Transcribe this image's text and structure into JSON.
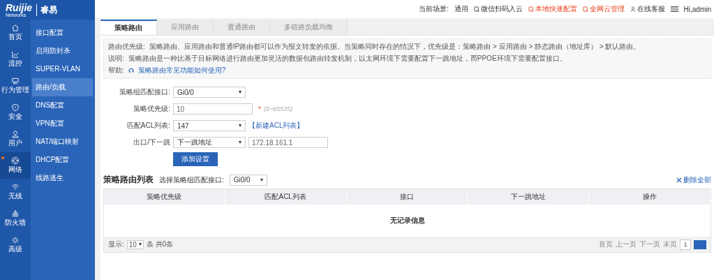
{
  "logo": {
    "brand": "Ruijie",
    "tagline": "Networks",
    "name": "睿易"
  },
  "header": {
    "scene_label": "当前场景:",
    "scene": "通用",
    "items": [
      {
        "label": "微信扫码入云",
        "emphasis": false
      },
      {
        "label": "本地快速配置",
        "emphasis": true
      },
      {
        "label": "全网云管理",
        "emphasis": true
      },
      {
        "label": "在线客服",
        "emphasis": false
      }
    ],
    "user": "Hi,admin"
  },
  "nav": [
    {
      "label": "首页",
      "selected": false
    },
    {
      "label": "流控",
      "selected": false
    },
    {
      "label": "行为管理",
      "selected": false
    },
    {
      "label": "安全",
      "selected": false
    },
    {
      "label": "用户",
      "selected": false
    },
    {
      "label": "网络",
      "selected": true
    },
    {
      "label": "无线",
      "selected": false
    },
    {
      "label": "防火墙",
      "selected": false
    },
    {
      "label": "高级",
      "selected": false
    }
  ],
  "submenu": [
    {
      "label": "接口配置",
      "selected": false
    },
    {
      "label": "启用防封杀",
      "selected": false
    },
    {
      "label": "SUPER-VLAN",
      "selected": false
    },
    {
      "label": "路由/负载",
      "selected": true
    },
    {
      "label": "DNS配置",
      "selected": false
    },
    {
      "label": "VPN配置",
      "selected": false
    },
    {
      "label": "NAT/端口映射",
      "selected": false
    },
    {
      "label": "DHCP配置",
      "selected": false
    },
    {
      "label": "线路逃生",
      "selected": false
    }
  ],
  "tabs": [
    {
      "label": "策略路由",
      "selected": true
    },
    {
      "label": "应用路由",
      "selected": false
    },
    {
      "label": "普通路由",
      "selected": false
    },
    {
      "label": "多链路负载均衡",
      "selected": false
    }
  ],
  "info": [
    {
      "label": "路由优先级:",
      "text": "策略路由、应用路由和普通IP路由都可以作为报文转发的依据。当策略同时存在的情况下，优先级是：策略路由 > 应用路由 > 静态路由（地址库） > 默认路由。"
    },
    {
      "label": "说明:",
      "text": "策略路由是一种比基于目标网络进行路由更加灵活的数据包路由转发机制，以太网环境下需要配置下一跳地址，而PPOE环境下需要配置接口。"
    }
  ],
  "help": {
    "label": "帮助:",
    "link": "策略路由常见功能如何使用?"
  },
  "form": [
    {
      "label": "策略组匹配接口:",
      "kind": "select",
      "value": "Gi0/0"
    },
    {
      "label": "策略优先级:",
      "kind": "input",
      "value": "10",
      "required": "*",
      "hint": "(0~65535)"
    },
    {
      "label": "匹配ACL列表:",
      "kind": "select",
      "value": "147",
      "link": "【新建ACL列表】"
    },
    {
      "label": "出口/下一跳",
      "kind": "select",
      "value": "下一跳地址",
      "extra_value": "172.18.161.1"
    }
  ],
  "submit": "添加设置",
  "list": {
    "title": "策略路由列表",
    "filter_label": "选择策略组匹配接口:",
    "filter_value": "Gi0/0",
    "delete_all": "删除全部",
    "columns": [
      "策略优先级",
      "匹配ACL列表",
      "接口",
      "下一跳地址",
      "操作"
    ],
    "empty": "无记录信息",
    "page_size_label": "显示:",
    "page_size": "10",
    "total": "条 共0条",
    "pager": [
      "首页",
      "上一页",
      "下一页",
      "末页"
    ],
    "page": "1"
  }
}
